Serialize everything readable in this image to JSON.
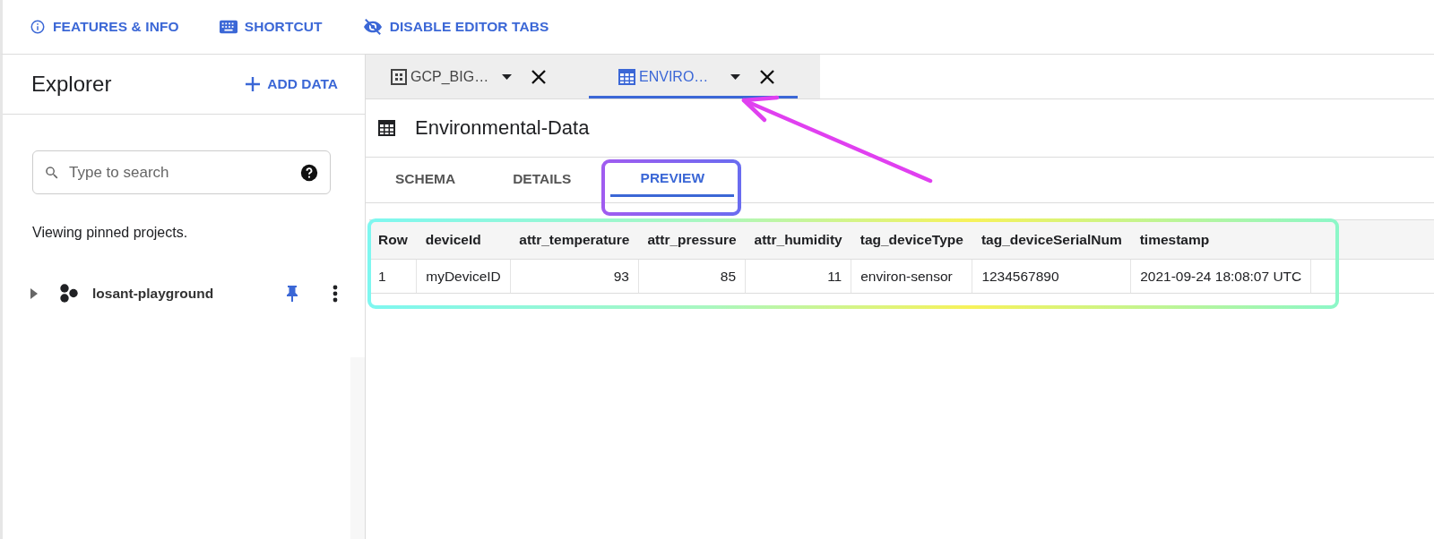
{
  "toolbar": [
    {
      "label": "FEATURES & INFO",
      "kind": "info"
    },
    {
      "label": "SHORTCUT",
      "kind": "keyboard"
    },
    {
      "label": "DISABLE EDITOR TABS",
      "kind": "eye-off"
    }
  ],
  "explorer": {
    "title": "Explorer",
    "add_button": "ADD DATA",
    "search": {
      "placeholder": "Type to search"
    },
    "note": "Viewing pinned projects.",
    "projects": [
      {
        "name": "losant-playground",
        "expanded": false,
        "pinned": true
      }
    ]
  },
  "editor_tabs": [
    {
      "label": "GCP_BIG…",
      "kind": "dataset",
      "selected": false
    },
    {
      "label": "ENVIRO…",
      "kind": "table",
      "selected": true
    }
  ],
  "table_title": "Environmental-Data",
  "subtabs": [
    {
      "label": "SCHEMA",
      "selected": false
    },
    {
      "label": "DETAILS",
      "selected": false
    },
    {
      "label": "PREVIEW",
      "selected": true
    }
  ],
  "preview": {
    "columns": [
      {
        "label": "Row",
        "kind": "text"
      },
      {
        "label": "deviceId",
        "kind": "text"
      },
      {
        "label": "attr_temperature",
        "kind": "number"
      },
      {
        "label": "attr_pressure",
        "kind": "number"
      },
      {
        "label": "attr_humidity",
        "kind": "number"
      },
      {
        "label": "tag_deviceType",
        "kind": "text"
      },
      {
        "label": "tag_deviceSerialNum",
        "kind": "text"
      },
      {
        "label": "timestamp",
        "kind": "text"
      }
    ],
    "rows": [
      [
        "1",
        "myDeviceID",
        "93",
        "85",
        "11",
        "environ-sensor",
        "1234567890",
        "2021-09-24 18:08:07 UTC"
      ]
    ]
  }
}
